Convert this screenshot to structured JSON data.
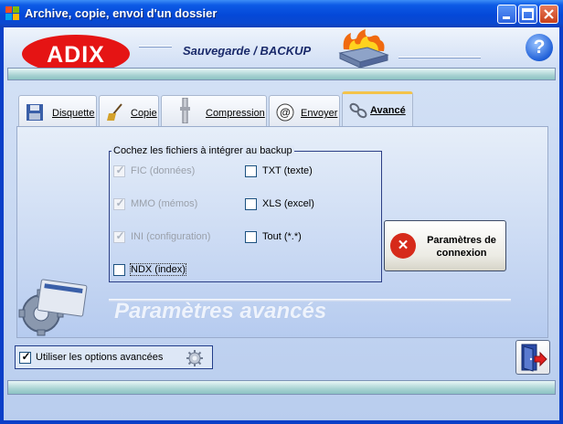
{
  "window": {
    "title": "Archive, copie, envoi d'un dossier",
    "controls": [
      "minimize",
      "maximize",
      "close"
    ]
  },
  "header": {
    "logo_text": "ADIX",
    "app_title": "Sauvegarde / BACKUP",
    "help_label": "?"
  },
  "tabs": [
    {
      "label": "Disquette",
      "icon": "floppy-icon",
      "active": false
    },
    {
      "label": "Copie",
      "icon": "broom-icon",
      "active": false
    },
    {
      "label": "Compression",
      "icon": "compress-icon",
      "active": false
    },
    {
      "label": "Envoyer",
      "icon": "email-icon",
      "active": false
    },
    {
      "label": "Avancé",
      "icon": "chain-icon",
      "active": true
    }
  ],
  "group": {
    "legend": "Cochez les fichiers à intégrer au backup",
    "left_column": [
      {
        "label": "FIC (données)",
        "checked": true,
        "disabled": true
      },
      {
        "label": "MMO (mémos)",
        "checked": true,
        "disabled": true
      },
      {
        "label": "INI (configuration)",
        "checked": true,
        "disabled": true
      },
      {
        "label": "NDX (index)",
        "checked": false,
        "disabled": false
      }
    ],
    "right_column": [
      {
        "label": "TXT (texte)",
        "checked": false,
        "disabled": false
      },
      {
        "label": "XLS (excel)",
        "checked": false,
        "disabled": false
      },
      {
        "label": "Tout (*.*)",
        "checked": false,
        "disabled": false
      }
    ]
  },
  "connection_button": {
    "label_line1": "Paramètres de",
    "label_line2": "connexion",
    "icon": "tools-icon"
  },
  "section_title": "Paramètres avancés",
  "options": {
    "label": "Utiliser les options avancées",
    "checked": true
  },
  "exit_button": {
    "icon": "exit-door-icon"
  },
  "colors": {
    "title_bar": "#0448d8",
    "logo_red": "#e51414",
    "active_tab_accent": "#f3c34a",
    "group_border": "#2c3f86"
  }
}
